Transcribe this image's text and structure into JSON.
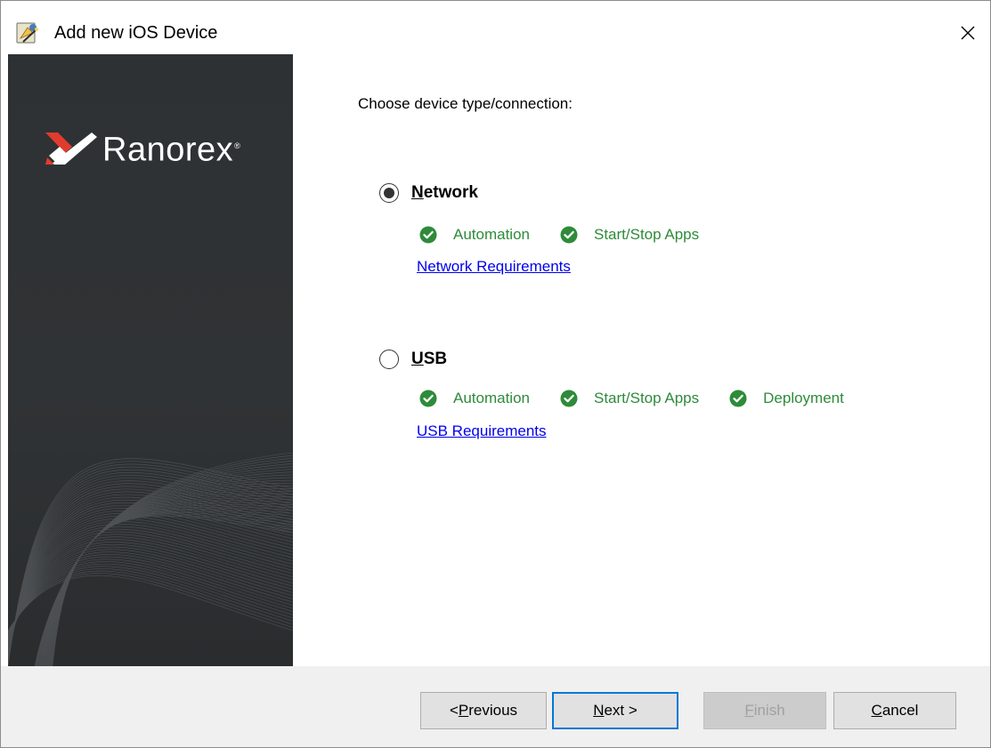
{
  "window": {
    "title": "Add new iOS Device",
    "close_glyph": "✕"
  },
  "banner": {
    "brand_name": "Ranorex",
    "brand_mark": "®"
  },
  "content": {
    "prompt": "Choose device type/connection:",
    "options": [
      {
        "label_accel": "N",
        "label_rest": "etwork",
        "selected": true,
        "features": [
          "Automation",
          "Start/Stop Apps"
        ],
        "link": "Network Requirements"
      },
      {
        "label_accel": "U",
        "label_rest": "SB",
        "selected": false,
        "features": [
          "Automation",
          "Start/Stop Apps",
          "Deployment"
        ],
        "link": "USB Requirements"
      }
    ]
  },
  "footer": {
    "previous": {
      "prefix": "< ",
      "accel": "P",
      "rest": "revious"
    },
    "next": {
      "accel": "N",
      "rest": "ext >"
    },
    "finish": {
      "accel": "F",
      "rest": "inish",
      "disabled": true
    },
    "cancel": {
      "accel": "C",
      "rest": "ancel"
    }
  },
  "colors": {
    "feature_green": "#2e8b3a",
    "link_blue": "#0000ee",
    "default_button_border": "#0078d7",
    "banner_bg": "#2e3133"
  },
  "icons": {
    "app": "device-wizard-icon",
    "close": "close-icon",
    "brand": "ranorex-logo-icon",
    "feature": "check-circle-icon"
  }
}
